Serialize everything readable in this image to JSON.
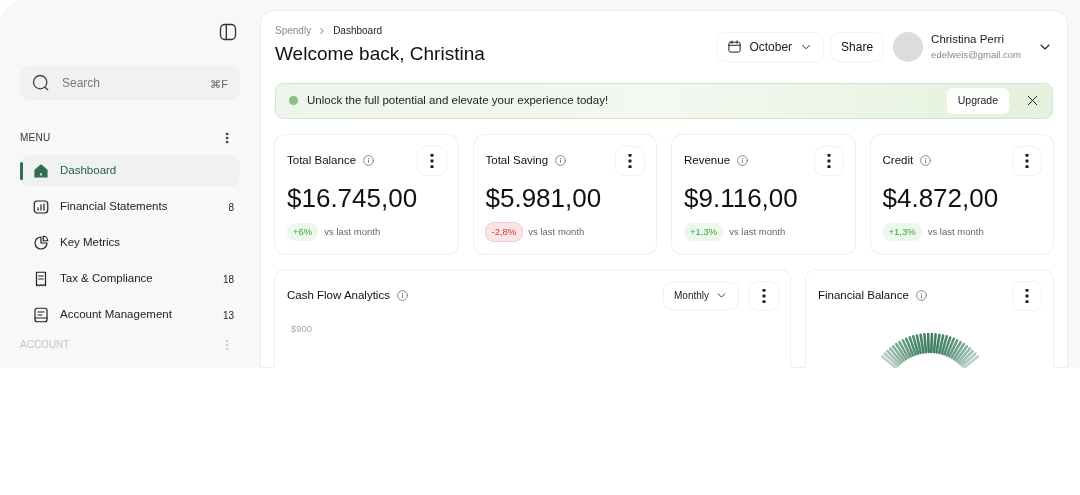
{
  "sidebar": {
    "search": {
      "placeholder": "Search",
      "shortcut": "⌘F"
    },
    "menu_label": "MENU",
    "items": [
      {
        "label": "Dashboard",
        "selected": true,
        "kind": "home"
      },
      {
        "label": "Financial Statements",
        "selected": false,
        "kind": "chart",
        "count": "8"
      },
      {
        "label": "Key Metrics",
        "selected": false,
        "kind": "pie"
      },
      {
        "label": "Tax & Compliance",
        "selected": false,
        "kind": "receipt",
        "count": "18"
      },
      {
        "label": "Account Management",
        "selected": false,
        "kind": "doc",
        "count": "13"
      }
    ],
    "account_label": "ACCOUNT"
  },
  "header": {
    "breadcrumb": [
      "Spendly",
      "Dashboard"
    ],
    "title": "Welcome back, Christina",
    "month": "October",
    "share": "Share",
    "user": {
      "name": "Christina Perri",
      "email": "edelweis@gmail.com"
    }
  },
  "banner": {
    "text": "Unlock the full potential and elevate your experience today!",
    "button": "Upgrade"
  },
  "stats": [
    {
      "title": "Total Balance",
      "value": "$16.745,00",
      "change": "+6%",
      "kind": "up",
      "note": "vs last month"
    },
    {
      "title": "Total Saving",
      "value": "$5.981,00",
      "change": "-2,8%",
      "kind": "down",
      "note": "vs last month"
    },
    {
      "title": "Revenue",
      "value": "$9.116,00",
      "change": "+1,3%",
      "kind": "up",
      "note": "vs last month"
    },
    {
      "title": "Credit",
      "value": "$4.872,00",
      "change": "+1,3%",
      "kind": "up",
      "note": "vs last month"
    }
  ],
  "cash_flow": {
    "title": "Cash Flow Analytics",
    "period": "Monthly",
    "axis_label": "$900"
  },
  "financial_balance": {
    "title": "Financial Balance"
  }
}
